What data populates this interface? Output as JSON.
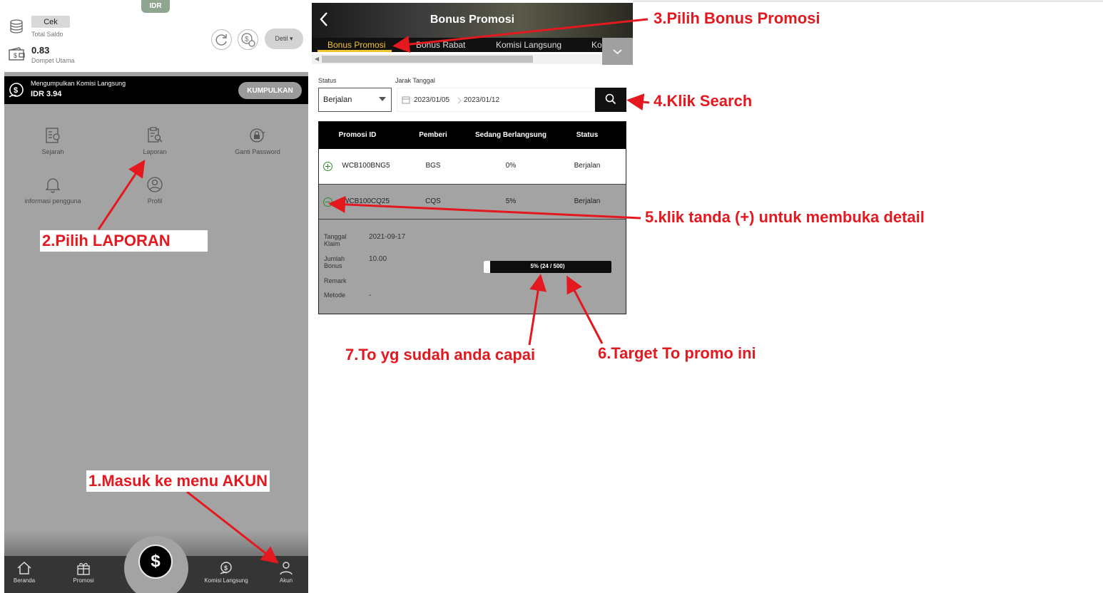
{
  "left_panel": {
    "currency_tab": "IDR",
    "check_button": "Cek",
    "total_balance_label": "Total Saldo",
    "main_wallet_amount": "0.83",
    "main_wallet_label": "Dompet Utama",
    "detail_button": "Detil ▾",
    "commission": {
      "title": "Mengumpulkan Komisi Langsung",
      "amount": "IDR 3.94",
      "collect_button": "KUMPULKAN"
    },
    "menu": [
      {
        "label": "Sejarah",
        "icon": "history-icon"
      },
      {
        "label": "Laporan",
        "icon": "report-icon"
      },
      {
        "label": "Ganti Password",
        "icon": "lock-icon"
      },
      {
        "label": "informasi pengguna",
        "icon": "bell-icon"
      },
      {
        "label": "Profil",
        "icon": "profile-icon"
      }
    ],
    "bottom_nav": [
      {
        "label": "Beranda",
        "icon": "home-icon"
      },
      {
        "label": "Promosi",
        "icon": "gift-icon"
      },
      {
        "label": "Komisi Langsung",
        "icon": "commission-icon"
      },
      {
        "label": "Akun",
        "icon": "user-icon"
      }
    ],
    "center_button": "$"
  },
  "bonus_page": {
    "title": "Bonus Promosi",
    "tabs": [
      {
        "label": "Bonus Promosi",
        "active": true
      },
      {
        "label": "Bonus Rabat",
        "active": false
      },
      {
        "label": "Komisi Langsung",
        "active": false
      },
      {
        "label": "Ko",
        "active": false
      }
    ],
    "filters": {
      "status_label": "Status",
      "status_value": "Berjalan",
      "date_label": "Jarak Tanggal",
      "date_from": "2023/01/05",
      "date_to": "2023/01/12"
    },
    "table": {
      "headers": [
        "Promosi ID",
        "Pemberi",
        "Sedang Berlangsung",
        "Status"
      ],
      "rows": [
        {
          "id": "WCB100BNG5",
          "provider": "BGS",
          "progress": "0%",
          "status": "Berjalan",
          "expanded": false
        },
        {
          "id": "WCB100CQ25",
          "provider": "CQS",
          "progress": "5%",
          "status": "Berjalan",
          "expanded": true
        }
      ],
      "detail": {
        "claim_date_label": "Tanggal Klaim",
        "claim_date": "2021-09-17",
        "bonus_amount_label": "Jumlah Bonus",
        "bonus_amount": "10.00",
        "remark_label": "Remark",
        "remark": "",
        "method_label": "Metode",
        "method": "-",
        "progress_text": "5% (24 / 500)",
        "progress_fraction": 0.048
      }
    }
  },
  "annotations": {
    "step1": "1.Masuk ke menu AKUN",
    "step2": "2.Pilih LAPORAN",
    "step3": "3.Pilih Bonus Promosi",
    "step4": "4.Klik Search",
    "step5": "5.klik tanda (+) untuk membuka detail",
    "step6": "6.Target To promo ini",
    "step7": "7.To yg sudah anda capai"
  },
  "colors": {
    "annotation_red": "#e3191f",
    "active_tab": "#f4c430",
    "panel_gray": "#a3a3a3",
    "plus_green": "#2e8b2e"
  }
}
